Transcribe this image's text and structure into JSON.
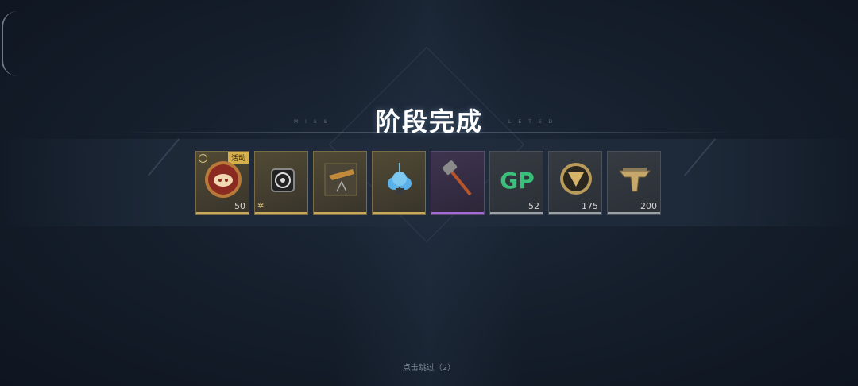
{
  "title": "阶段完成",
  "skip_text": "点击跳过（2）",
  "deco_left": "MISS",
  "deco_right": "LETED",
  "rewards": [
    {
      "icon": "coin-piggy-icon",
      "count": "50",
      "tag": "活动",
      "rarity": "gold"
    },
    {
      "icon": "badge-emblem-icon",
      "count": "",
      "rarity": "gold"
    },
    {
      "icon": "weapon-blueprint-icon",
      "count": "",
      "rarity": "gold"
    },
    {
      "icon": "cloud-charm-icon",
      "count": "",
      "rarity": "gold"
    },
    {
      "icon": "hammer-skin-icon",
      "count": "",
      "rarity": "purple"
    },
    {
      "icon": "gp-currency-icon",
      "count": "52",
      "rarity": "gray"
    },
    {
      "icon": "gold-emblem-icon",
      "count": "175",
      "rarity": "gray"
    },
    {
      "icon": "tier-badge-icon",
      "count": "200",
      "rarity": "gray"
    }
  ],
  "colors": {
    "gold_bar": "#c8a85a",
    "purple_bar": "#a46ad6",
    "gray_bar": "#9aa1a9",
    "tag_bg": "#d8b04a"
  }
}
